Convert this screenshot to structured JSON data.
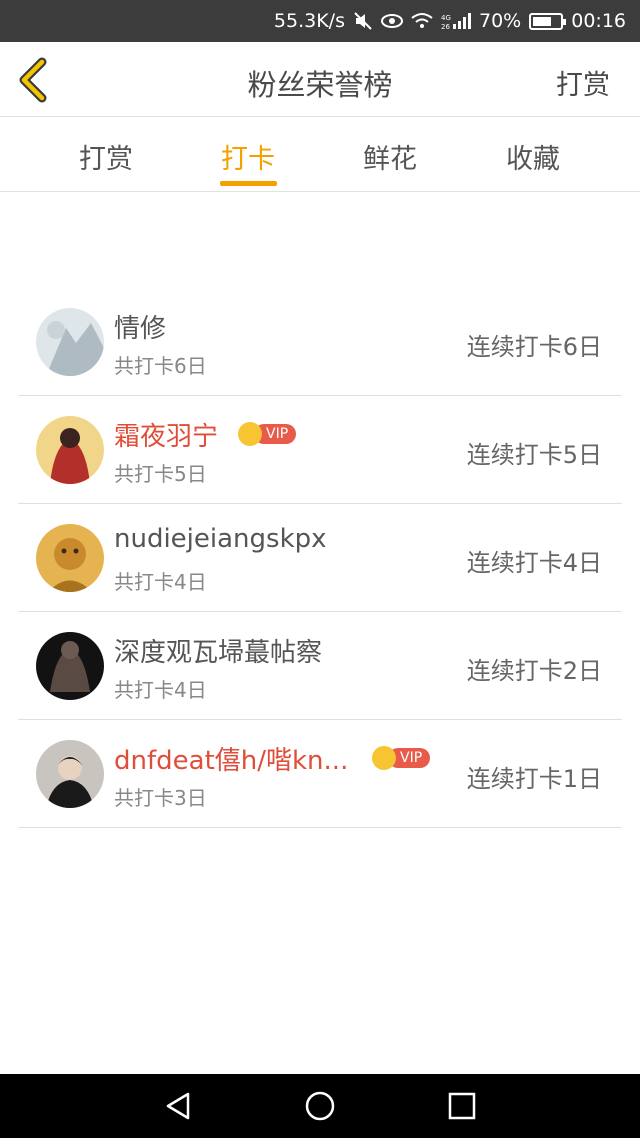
{
  "status_bar": {
    "speed": "55.3K/s",
    "battery": "70%",
    "battery_level": 0.7,
    "time": "00:16"
  },
  "header": {
    "title": "粉丝荣誉榜",
    "right_action": "打赏"
  },
  "tabs": [
    {
      "label": "打赏",
      "active": false
    },
    {
      "label": "打卡",
      "active": true
    },
    {
      "label": "鲜花",
      "active": false
    },
    {
      "label": "收藏",
      "active": false
    }
  ],
  "list": [
    {
      "name": "情修",
      "sub": "共打卡6日",
      "streak": "连续打卡6日",
      "vip": false
    },
    {
      "name": "霜夜羽宁",
      "sub": "共打卡5日",
      "streak": "连续打卡5日",
      "vip": true,
      "vip_label": "VIP"
    },
    {
      "name": "nudiejeiangskpx",
      "sub": "共打卡4日",
      "streak": "连续打卡4日",
      "vip": false
    },
    {
      "name": "深度观瓦埽蕞帖察",
      "sub": "共打卡4日",
      "streak": "连续打卡2日",
      "vip": false
    },
    {
      "name": "dnfdeat僖h/喈kn...",
      "sub": "共打卡3日",
      "streak": "连续打卡1日",
      "vip": true,
      "vip_label": "VIP"
    }
  ],
  "colors": {
    "accent": "#f4a100",
    "vip_name": "#e04e3a",
    "status_bar_bg": "#3c3c3c"
  }
}
